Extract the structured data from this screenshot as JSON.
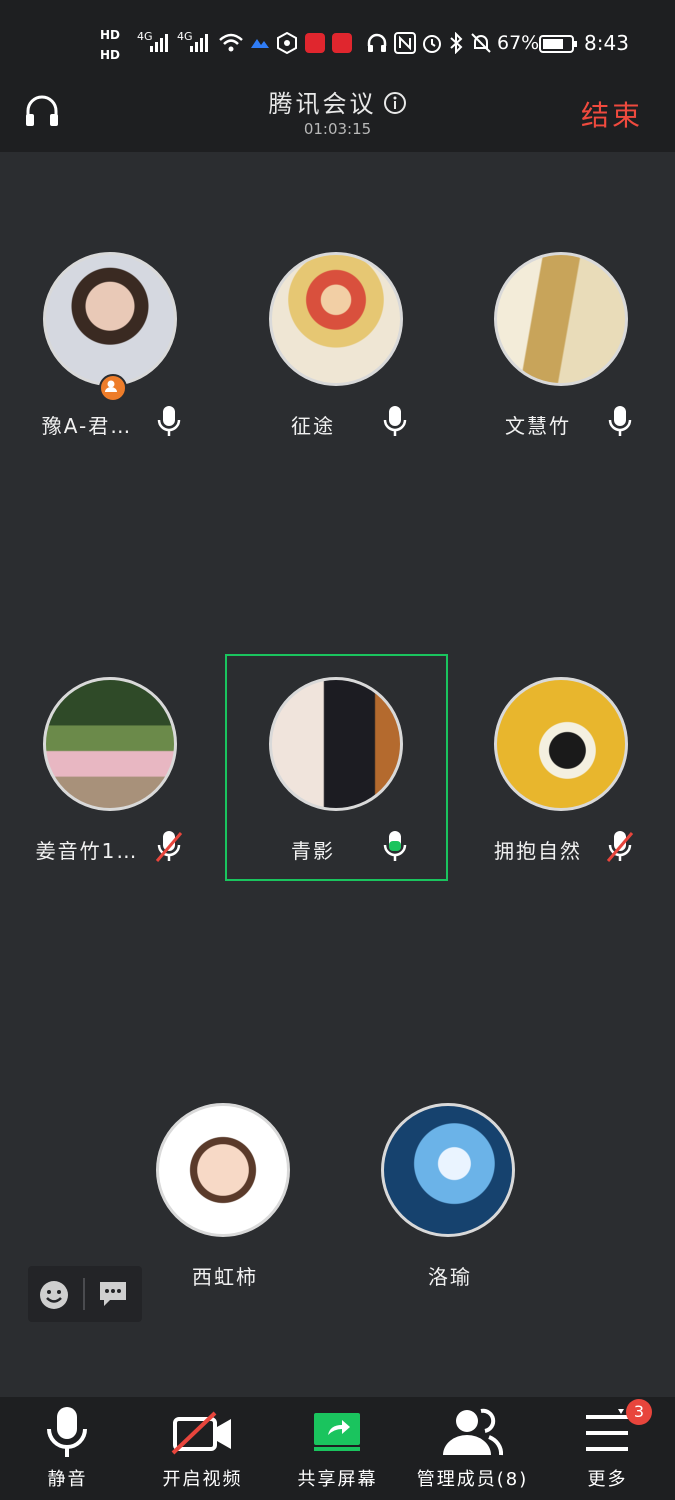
{
  "status_bar": {
    "network_labels": [
      "HD",
      "HD",
      "4G",
      "4G"
    ],
    "battery_percent": "67%",
    "time": "8:43"
  },
  "header": {
    "title": "腾讯会议",
    "timer": "01:03:15",
    "end_label": "结束"
  },
  "participants": [
    {
      "name": "豫A-君…",
      "mic": "on",
      "host": true
    },
    {
      "name": "征途",
      "mic": "on",
      "host": false
    },
    {
      "name": "文慧竹",
      "mic": "on",
      "host": false
    },
    {
      "name": "姜音竹1…",
      "mic": "muted",
      "host": false
    },
    {
      "name": "青影",
      "mic": "speaking",
      "host": false
    },
    {
      "name": "拥抱自然",
      "mic": "muted",
      "host": false
    },
    {
      "name": "西虹柿",
      "mic": "none",
      "host": false
    },
    {
      "name": "洛瑜",
      "mic": "none",
      "host": false
    }
  ],
  "toolbar": {
    "mute_label": "静音",
    "video_label": "开启视频",
    "share_label": "共享屏幕",
    "members_label": "管理成员(8)",
    "more_label": "更多",
    "more_badge": "3"
  },
  "colors": {
    "accent_green": "#1ac45e",
    "end_red": "#f04a3e",
    "badge_red": "#e8453c",
    "host_orange": "#ee7d2a"
  }
}
